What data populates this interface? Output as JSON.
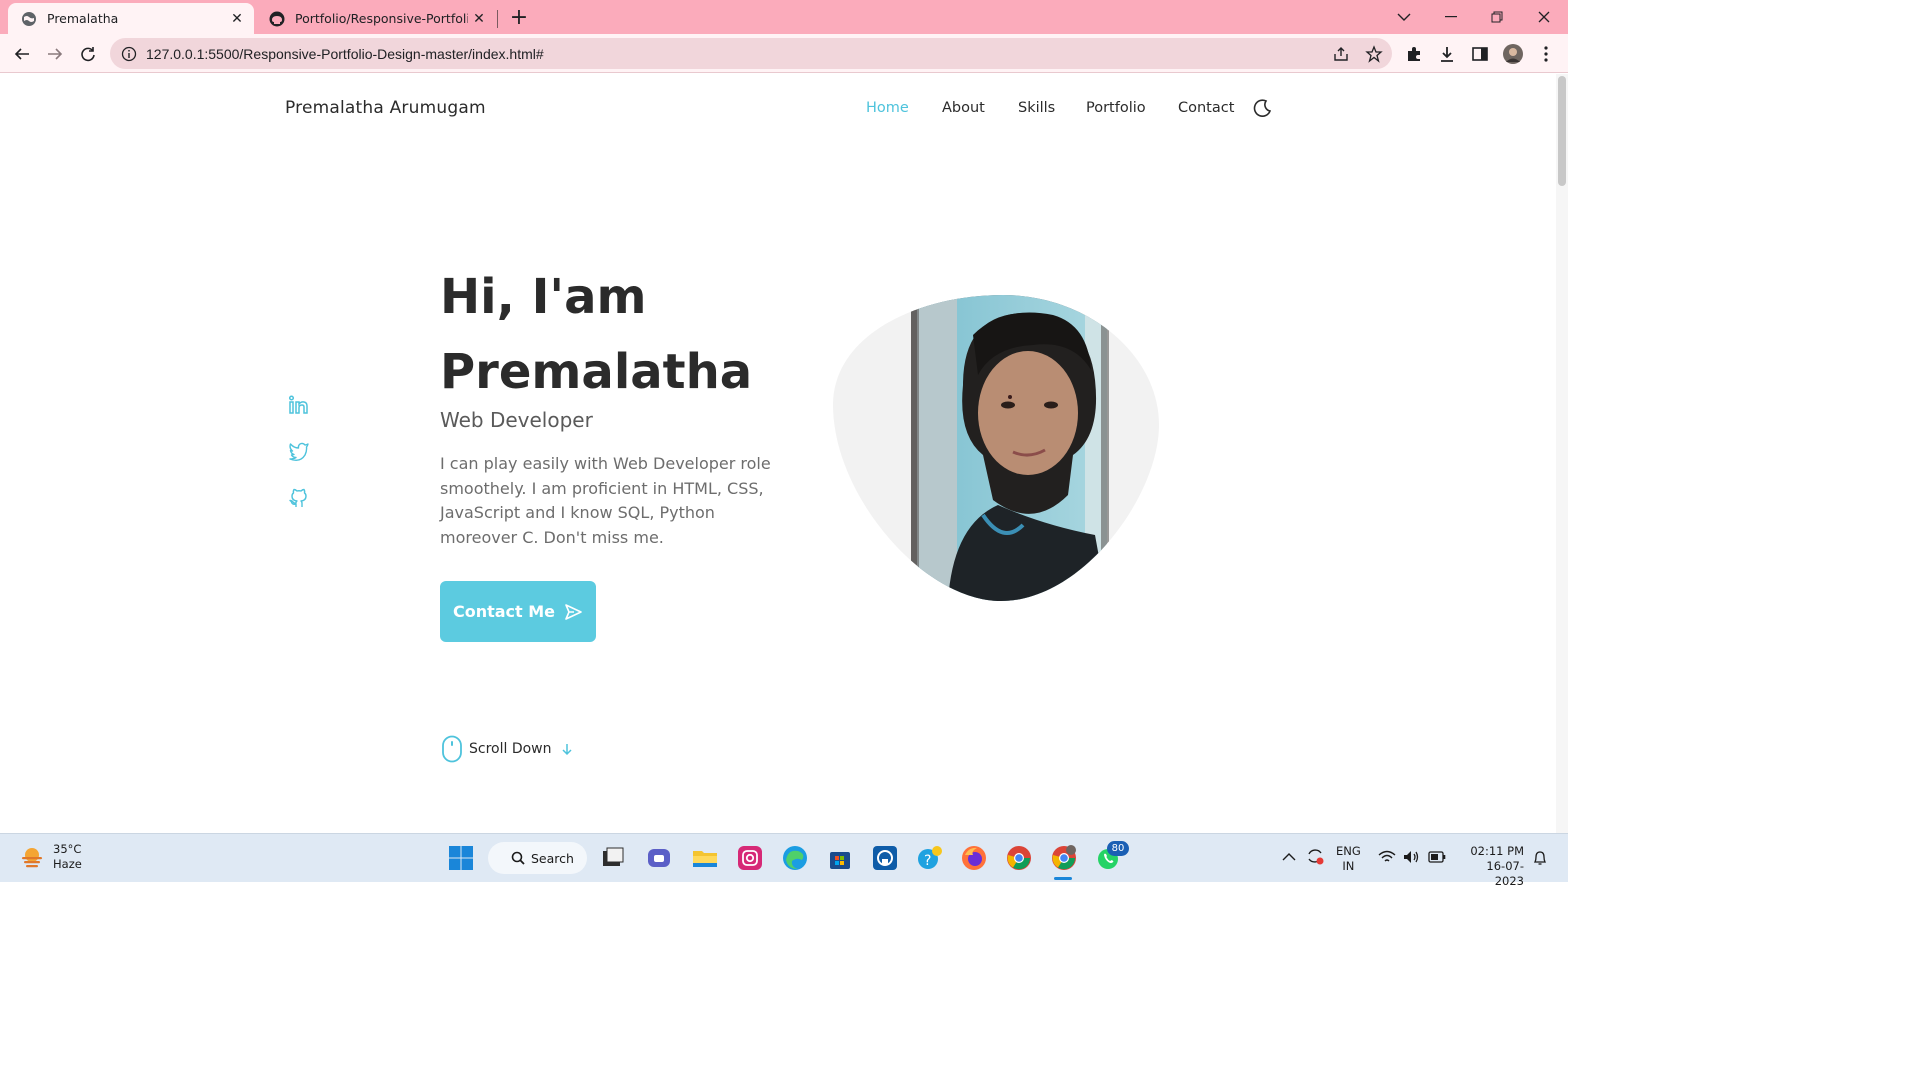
{
  "browser": {
    "tabs": [
      {
        "title": "Premalatha",
        "active": true
      },
      {
        "title": "Portfolio/Responsive-Portfolio-Design",
        "active": false
      }
    ],
    "url": "127.0.0.1:5500/Responsive-Portfolio-Design-master/index.html#",
    "accent": "#fbabbb"
  },
  "header": {
    "brand": "Premalatha Arumugam",
    "nav": [
      "Home",
      "About",
      "Skills",
      "Portfolio",
      "Contact"
    ],
    "active_nav": "Home",
    "theme_icon": "moon-icon"
  },
  "social": [
    "linkedin-icon",
    "twitter-icon",
    "github-icon"
  ],
  "hero": {
    "greeting": "Hi, I'am",
    "name": "Premalatha",
    "role": "Web Developer",
    "description": "I can play easily with Web Developer role smoothely. I am proficient in HTML, CSS, JavaScript and I know SQL, Python moreover C. Don't miss me.",
    "cta_label": "Contact Me",
    "scroll_label": "Scroll Down",
    "accent": "#5ccbe0"
  },
  "taskbar": {
    "weather_temp": "35°C",
    "weather_desc": "Haze",
    "search_label": "Search",
    "whatsapp_badge": "80",
    "lang_top": "ENG",
    "lang_bottom": "IN",
    "time": "02:11 PM",
    "date": "16-07-2023"
  }
}
